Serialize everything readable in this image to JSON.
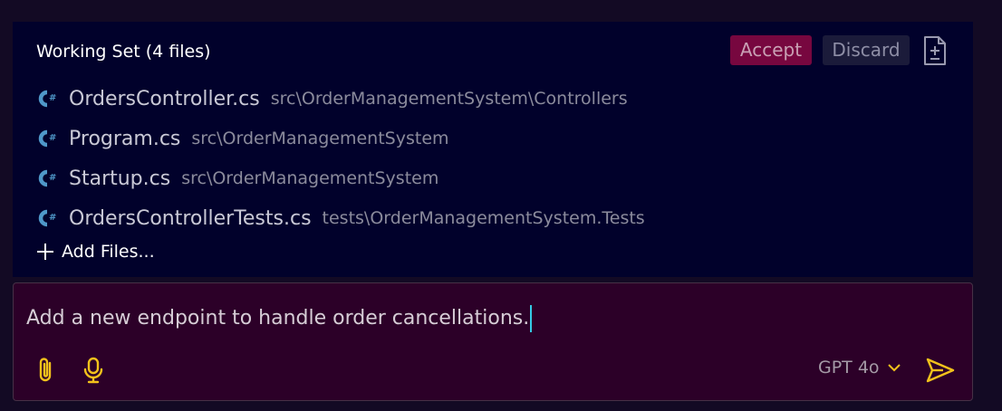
{
  "working_set": {
    "title": "Working Set (4 files)",
    "accept_label": "Accept",
    "discard_label": "Discard",
    "files": [
      {
        "name": "OrdersController.cs",
        "path": "src\\OrderManagementSystem\\Controllers",
        "icon": "csharp-icon"
      },
      {
        "name": "Program.cs",
        "path": "src\\OrderManagementSystem",
        "icon": "csharp-icon"
      },
      {
        "name": "Startup.cs",
        "path": "src\\OrderManagementSystem",
        "icon": "csharp-icon"
      },
      {
        "name": "OrdersControllerTests.cs",
        "path": "tests\\OrderManagementSystem.Tests",
        "icon": "csharp-icon"
      }
    ],
    "add_files_label": "Add Files..."
  },
  "chat": {
    "input_value": "Add a new endpoint to handle order cancellations.",
    "model": "GPT 4o"
  },
  "colors": {
    "accent_yellow": "#f2c21b",
    "csharp_blue": "#4f98c9",
    "accept_bg": "#77073f",
    "caret": "#35c9e6"
  }
}
